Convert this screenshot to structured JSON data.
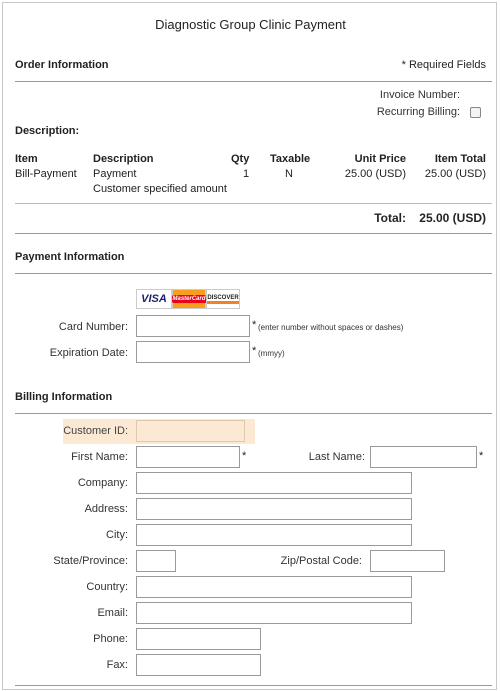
{
  "page_title": "Diagnostic Group Clinic Payment",
  "order": {
    "heading": "Order Information",
    "required_note": "* Required Fields",
    "invoice_label": "Invoice Number:",
    "recurring_label": "Recurring Billing:",
    "recurring_checked": false,
    "description_label": "Description:"
  },
  "table": {
    "headers": {
      "item": "Item",
      "description": "Description",
      "qty": "Qty",
      "taxable": "Taxable",
      "unit_price": "Unit Price",
      "item_total": "Item Total"
    },
    "row": {
      "item": "Bill-Payment",
      "description": "Payment",
      "description_sub": "Customer specified amount",
      "qty": "1",
      "taxable": "N",
      "unit_price": "25.00 (USD)",
      "item_total": "25.00 (USD)"
    },
    "total_label": "Total:",
    "total_value": "25.00 (USD)"
  },
  "payment": {
    "heading": "Payment Information",
    "cards": {
      "visa": "VISA",
      "mastercard": "MasterCard",
      "discover": "DISCOVER"
    },
    "card_number_label": "Card Number:",
    "card_number_hint": "(enter number without spaces or dashes)",
    "expiration_label": "Expiration Date:",
    "expiration_hint": "(mmyy)",
    "asterisk": "*"
  },
  "billing": {
    "heading": "Billing Information",
    "customer_id_label": "Customer ID:",
    "first_name_label": "First Name:",
    "last_name_label": "Last Name:",
    "company_label": "Company:",
    "address_label": "Address:",
    "city_label": "City:",
    "state_label": "State/Province:",
    "zip_label": "Zip/Postal Code:",
    "country_label": "Country:",
    "email_label": "Email:",
    "phone_label": "Phone:",
    "fax_label": "Fax:",
    "asterisk": "*"
  },
  "colors": {
    "highlight": "#fbe9d3",
    "visa_blue": "#1a1f71",
    "mastercard_red": "#eb001b",
    "mastercard_orange": "#f79e1b",
    "discover_orange": "#f58220"
  }
}
